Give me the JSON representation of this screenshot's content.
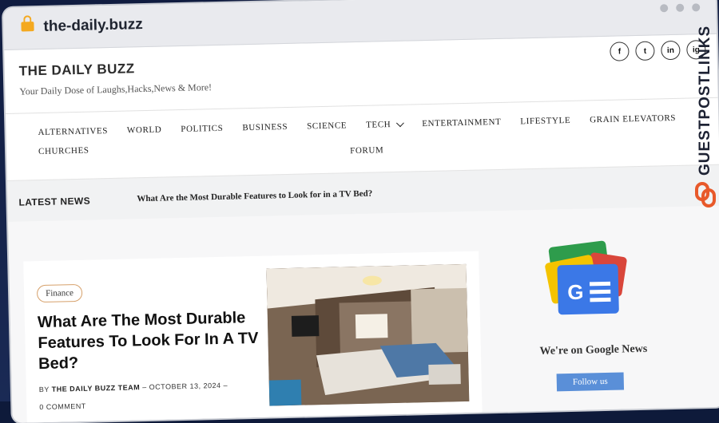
{
  "browser": {
    "url": "the-daily.buzz"
  },
  "header": {
    "site_title": "THE DAILY BUZZ",
    "tagline": "Your Daily Dose of Laughs,Hacks,News & More!",
    "social": [
      "f",
      "t",
      "in",
      "ig"
    ]
  },
  "nav": {
    "items": [
      "ALTERNATIVES",
      "WORLD",
      "POLITICS",
      "BUSINESS",
      "SCIENCE",
      "TECH",
      "ENTERTAINMENT",
      "LIFESTYLE",
      "GRAIN ELEVATORS",
      "CHURCHES"
    ],
    "second_row": "FORUM"
  },
  "ticker": {
    "label": "LATEST NEWS",
    "headline": "What Are the Most Durable Features to Look for in a TV Bed?"
  },
  "article": {
    "category": "Finance",
    "title": "What Are The Most Durable Features To Look For In A TV Bed?",
    "by_prefix": "BY",
    "author": "THE DAILY BUZZ TEAM",
    "date": "OCTOBER 13, 2024",
    "comments": "0 COMMENT"
  },
  "sidebar": {
    "caption": "We're on Google News",
    "button": "Follow us"
  },
  "watermark": {
    "text": "GUESTPOSTLINKS"
  },
  "colors": {
    "accent_badge": "#d6a06a",
    "follow_button": "#5a8fd8",
    "lock": "#f4a920",
    "watermark_logo": "#e8592a"
  }
}
